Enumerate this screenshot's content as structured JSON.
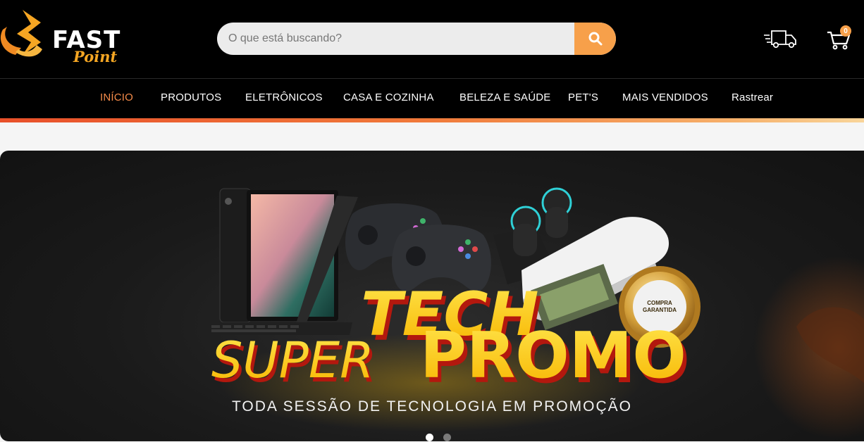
{
  "header": {
    "logo": {
      "brand_top": "FAST",
      "brand_bottom": "Point"
    },
    "search": {
      "placeholder": "O que está buscando?"
    },
    "cart_count": "0"
  },
  "nav": {
    "items": [
      {
        "label": "INÍCIO",
        "active": true
      },
      {
        "label": "PRODUTOS"
      },
      {
        "label": "ELETRÔNICOS"
      },
      {
        "label": "CASA E COZINHA"
      },
      {
        "label": "BELEZA E SAÚDE"
      },
      {
        "label": "PET'S"
      },
      {
        "label": "MAIS VENDIDOS"
      },
      {
        "label": "Rastrear"
      }
    ]
  },
  "banner": {
    "headline_1": "TECH",
    "headline_2a": "SUPER",
    "headline_2b": "PROMO",
    "badge": "COMPRA GARANTIDA",
    "subtitle": "TODA SESSÃO DE TECNOLOGIA EM PROMOÇÃO",
    "carousel": {
      "slides": 2,
      "active": 1
    }
  },
  "colors": {
    "accent": "#f7a04a",
    "nav_active": "#f68c4a",
    "header_bg": "#000000",
    "promo_yellow": "#ffd21f",
    "promo_red": "#d6281c"
  },
  "icons": {
    "search": "search-icon",
    "shipping": "truck-icon",
    "cart": "cart-icon"
  }
}
